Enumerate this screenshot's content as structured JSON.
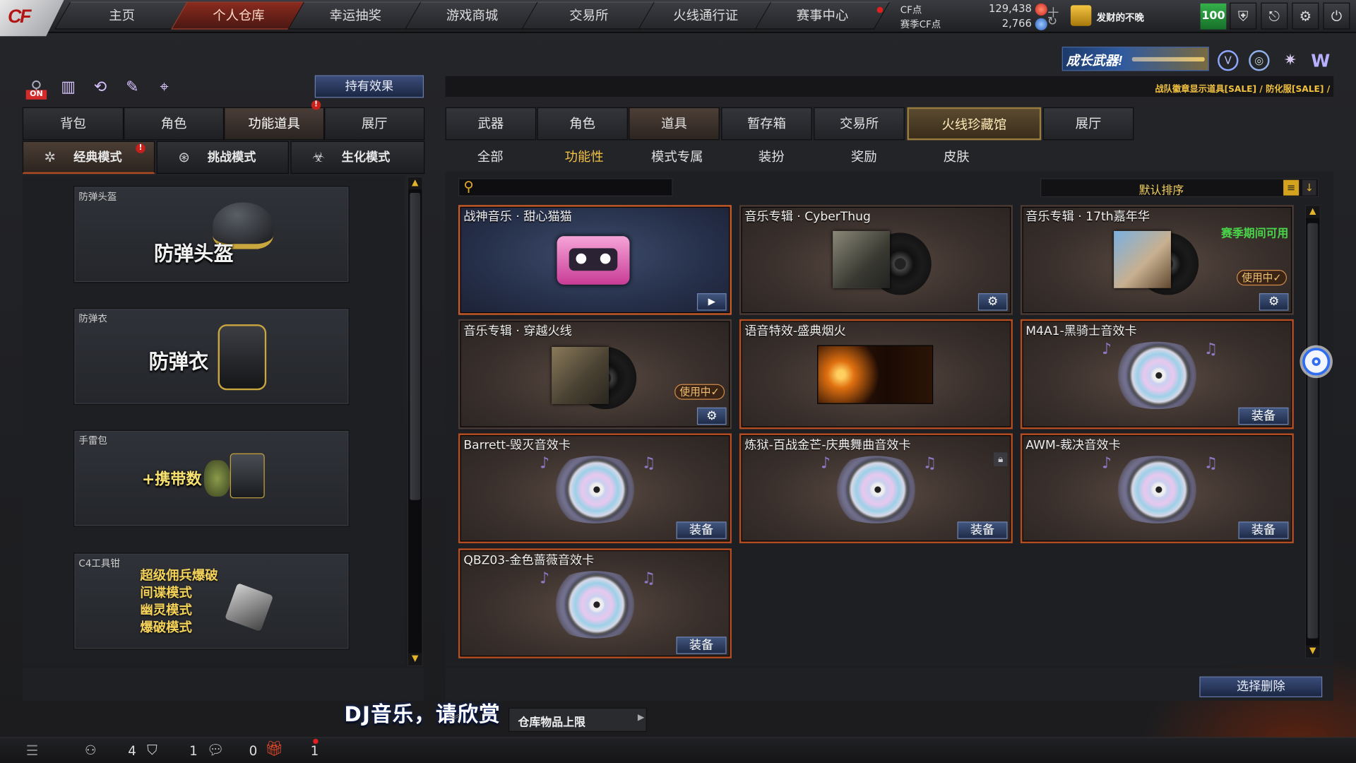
{
  "nav": {
    "logo": "CF",
    "tabs": [
      "主页",
      "个人仓库",
      "幸运抽奖",
      "游戏商城",
      "交易所",
      "火线通行证",
      "赛事中心"
    ],
    "active": "个人仓库"
  },
  "currency": {
    "cf_label": "CF点",
    "cf_value": "129,438",
    "season_label": "赛季CF点",
    "season_value": "2,766"
  },
  "user": {
    "name": "发财的不晚",
    "level": "100"
  },
  "banner": {
    "text": "成长武器!",
    "notice": "战队徽章显示道具[SALE] / 防化服[SALE] /"
  },
  "left": {
    "on_badge": "ON",
    "hold_effect": "持有效果",
    "tabs": [
      "背包",
      "角色",
      "功能道具",
      "展厅"
    ],
    "modes": [
      "经典模式",
      "挑战模式",
      "生化模式"
    ],
    "cards": [
      {
        "cat": "防弹头盔",
        "big": "防弹头盔"
      },
      {
        "cat": "防弹衣",
        "big": "防弹衣"
      },
      {
        "cat": "手雷包",
        "big": "+携带数"
      },
      {
        "cat": "C4工具钳",
        "lines": [
          "超级佣兵爆破",
          "间谍模式",
          "幽灵模式",
          "爆破模式"
        ]
      }
    ]
  },
  "right": {
    "tabs": [
      "武器",
      "角色",
      "道具",
      "暂存箱",
      "交易所",
      "火线珍藏馆",
      "展厅"
    ],
    "subtabs": [
      "全部",
      "功能性",
      "模式专属",
      "装扮",
      "奖励",
      "皮肤"
    ],
    "search_placeholder": "",
    "sort": "默认排序",
    "items": [
      {
        "name": "战神音乐 · 甜心猫猫"
      },
      {
        "name": "音乐专辑 · CyberThug"
      },
      {
        "name": "音乐专辑 · 17th嘉年华",
        "season": "赛季期间可用",
        "inuse": "使用中✓"
      },
      {
        "name": "音乐专辑 · 穿越火线",
        "inuse": "使用中✓"
      },
      {
        "name": "语音特效-盛典烟火"
      },
      {
        "name": "M4A1-黑骑士音效卡",
        "equip": "装备"
      },
      {
        "name": "Barrett-毁灭音效卡",
        "equip": "装备"
      },
      {
        "name": "炼狱-百战金芒-庆典舞曲音效卡",
        "equip": "装备"
      },
      {
        "name": "AWM-裁决音效卡",
        "equip": "装备"
      },
      {
        "name": "QBZ03-金色蔷薇音效卡",
        "equip": "装备"
      }
    ],
    "select_delete": "选择删除"
  },
  "subtitle": "DJ音乐，请欣赏",
  "storage_limit": "仓库物品上限",
  "bottom": {
    "count1": "4",
    "count2": "1",
    "count3": "0",
    "count4": "1"
  }
}
